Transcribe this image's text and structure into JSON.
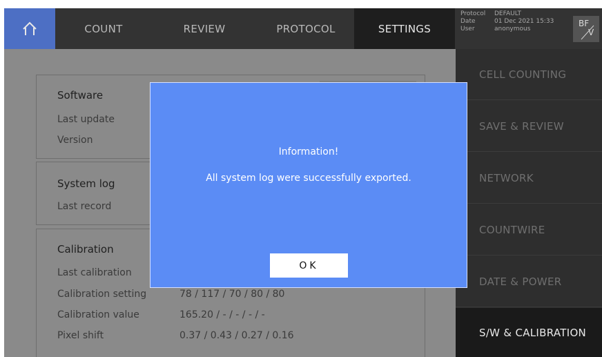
{
  "header": {
    "tabs": [
      {
        "label": "COUNT"
      },
      {
        "label": "REVIEW"
      },
      {
        "label": "PROTOCOL"
      },
      {
        "label": "SETTINGS",
        "active": true
      }
    ],
    "info": {
      "protocol_key": "Protocol",
      "protocol_val": "DEFAULT",
      "date_key": "Date",
      "date_val": "01 Dec 2021 15:33",
      "user_key": "User",
      "user_val": "anonymous"
    },
    "mode_top": "BF",
    "mode_bottom": "V"
  },
  "main": {
    "software": {
      "title": "Software",
      "last_update_label": "Last update",
      "version_label": "Version"
    },
    "system_log": {
      "title": "System log",
      "last_record_label": "Last record"
    },
    "calibration": {
      "title": "Calibration",
      "last_calibration_label": "Last calibration",
      "setting_label": "Calibration setting",
      "setting_value": "78 / 117 / 70 / 80 / 80",
      "value_label": "Calibration value",
      "value_value": "165.20 / - / - / - / -",
      "pixel_label": "Pixel shift",
      "pixel_value": "0.37 / 0.43 / 0.27 / 0.16"
    }
  },
  "sidebar": {
    "items": [
      {
        "label": "CELL COUNTING"
      },
      {
        "label": "SAVE & REVIEW"
      },
      {
        "label": "NETWORK"
      },
      {
        "label": "COUNTWIRE"
      },
      {
        "label": "DATE & POWER"
      },
      {
        "label": "S/W & CALIBRATION",
        "active": true
      }
    ]
  },
  "dialog": {
    "title": "Information!",
    "message": "All system log were successfully exported.",
    "ok_label": "OK"
  },
  "colors": {
    "accent": "#4d6fc4",
    "dialog_bg": "#5b8cf5",
    "topbar_bg": "#333333",
    "dimmed_bg": "#8a8a8a"
  },
  "icons": {
    "home": "home-icon"
  }
}
